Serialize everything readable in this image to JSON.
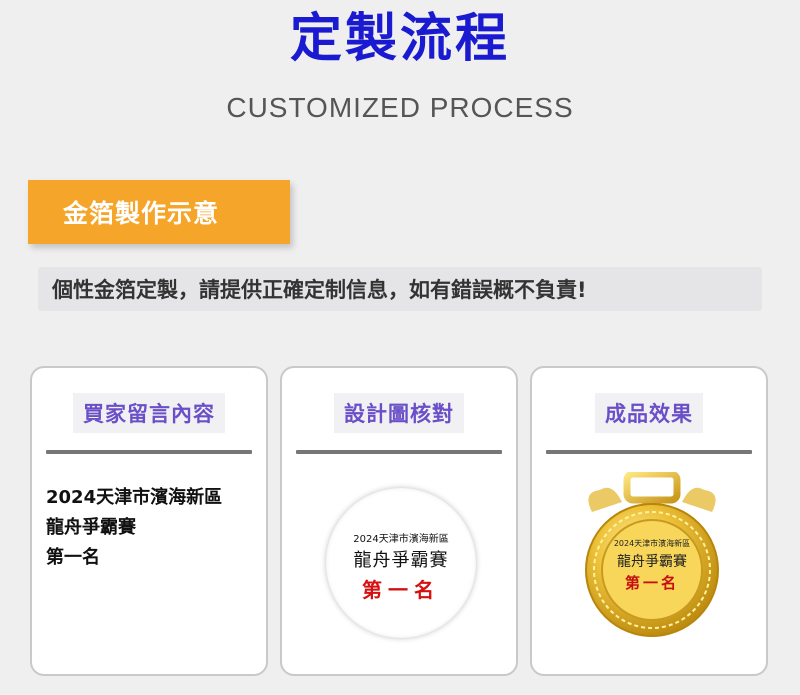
{
  "header": {
    "title": "定製流程",
    "subtitle": "CUSTOMIZED PROCESS"
  },
  "badge": {
    "label": "金箔製作示意"
  },
  "notice": {
    "text": "個性金箔定製，請提供正確定制信息，如有錯誤概不負責!"
  },
  "cards": [
    {
      "heading": "買家留言內容",
      "lines": [
        "2024天津市濱海新區",
        "龍舟爭霸賽",
        "第一名"
      ]
    },
    {
      "heading": "設計圖核對",
      "disc": {
        "line1": "2024天津市濱海新區",
        "line2": "龍舟爭霸賽",
        "line3": "第一名"
      }
    },
    {
      "heading": "成品效果",
      "medal": {
        "line1": "2024天津市濱海新區",
        "line2": "龍舟爭霸賽",
        "line3": "第一名"
      }
    }
  ],
  "colors": {
    "title": "#1a1ad0",
    "badge_bg": "#f5a52a",
    "card_heading": "#6a4fc8",
    "rank_red": "#d41010",
    "gold": "#e6b422"
  }
}
